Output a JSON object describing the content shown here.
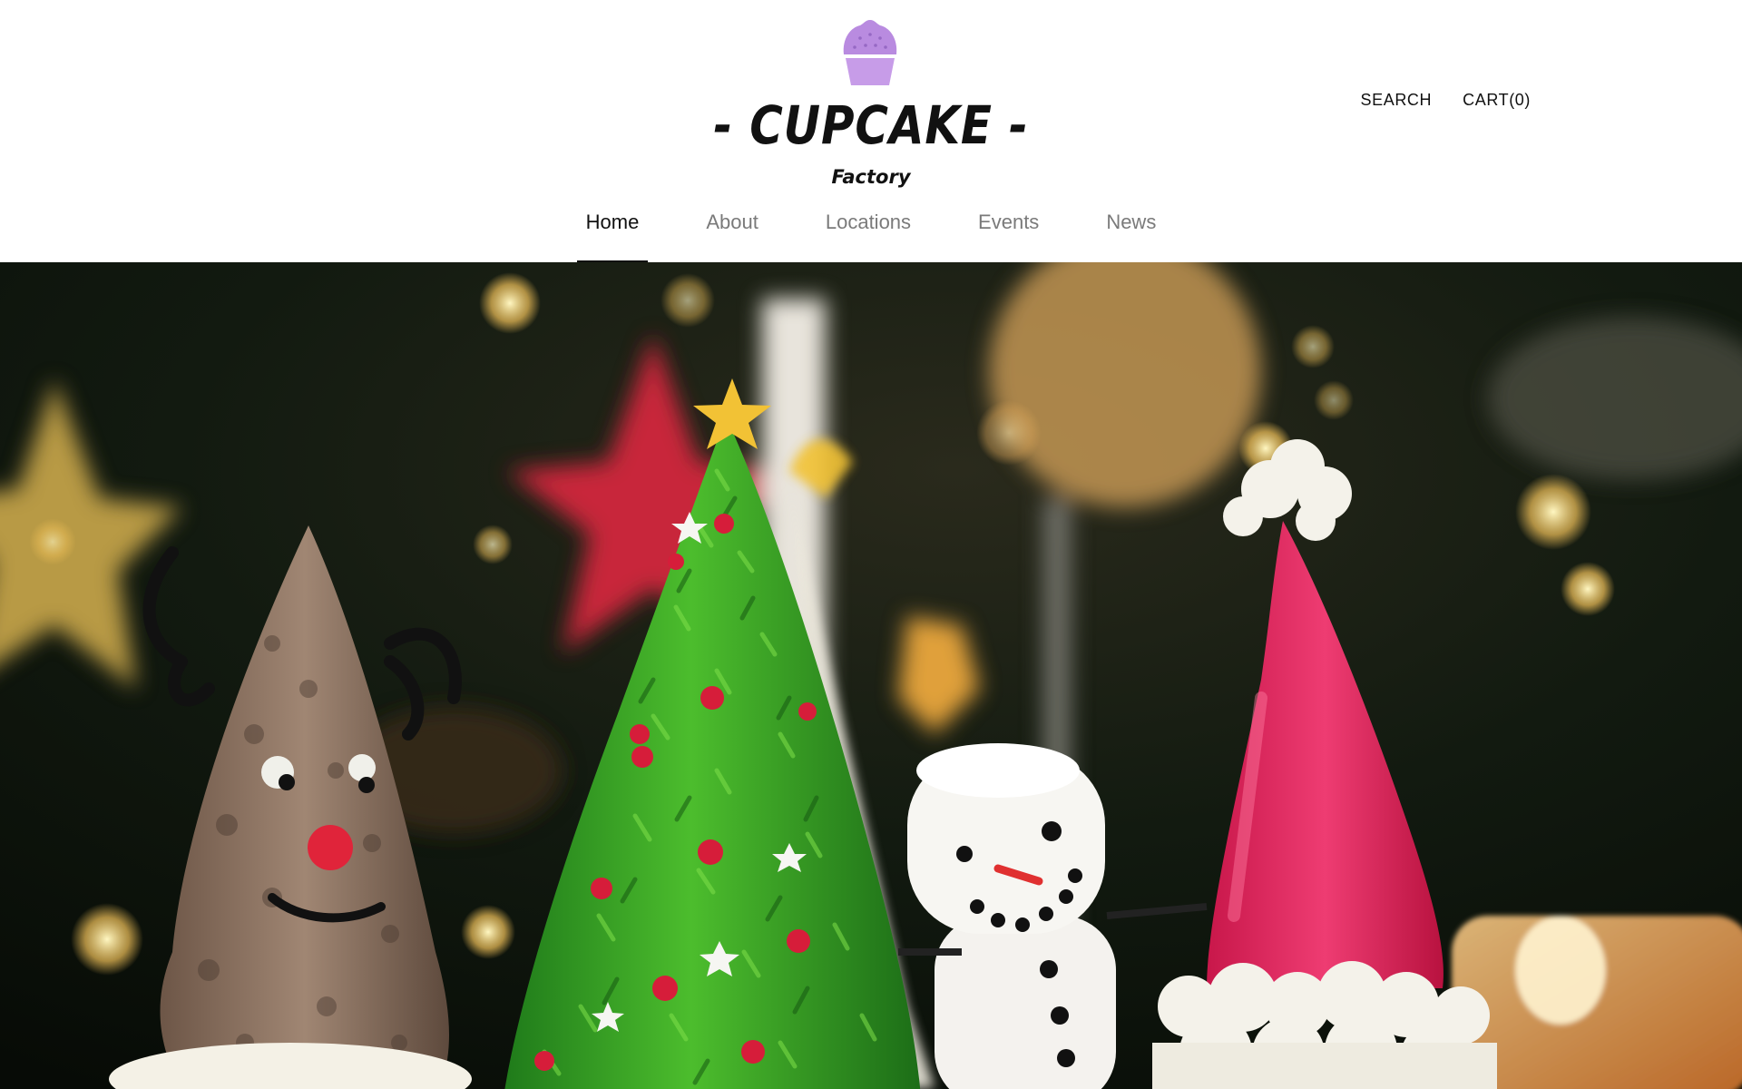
{
  "brand": {
    "name": "- CUPCAKE -",
    "subtitle": "Factory",
    "logo_icon": "cupcake-icon"
  },
  "utility_nav": {
    "search_label": "SEARCH",
    "cart_label": "CART(0)"
  },
  "main_nav": {
    "items": [
      {
        "label": "Home",
        "active": true
      },
      {
        "label": "About",
        "active": false
      },
      {
        "label": "Locations",
        "active": false
      },
      {
        "label": "Events",
        "active": false
      },
      {
        "label": "News",
        "active": false
      }
    ]
  },
  "colors": {
    "logo_purple": "#b98be0",
    "text": "#111111",
    "nav_inactive": "#7a7a7a"
  }
}
